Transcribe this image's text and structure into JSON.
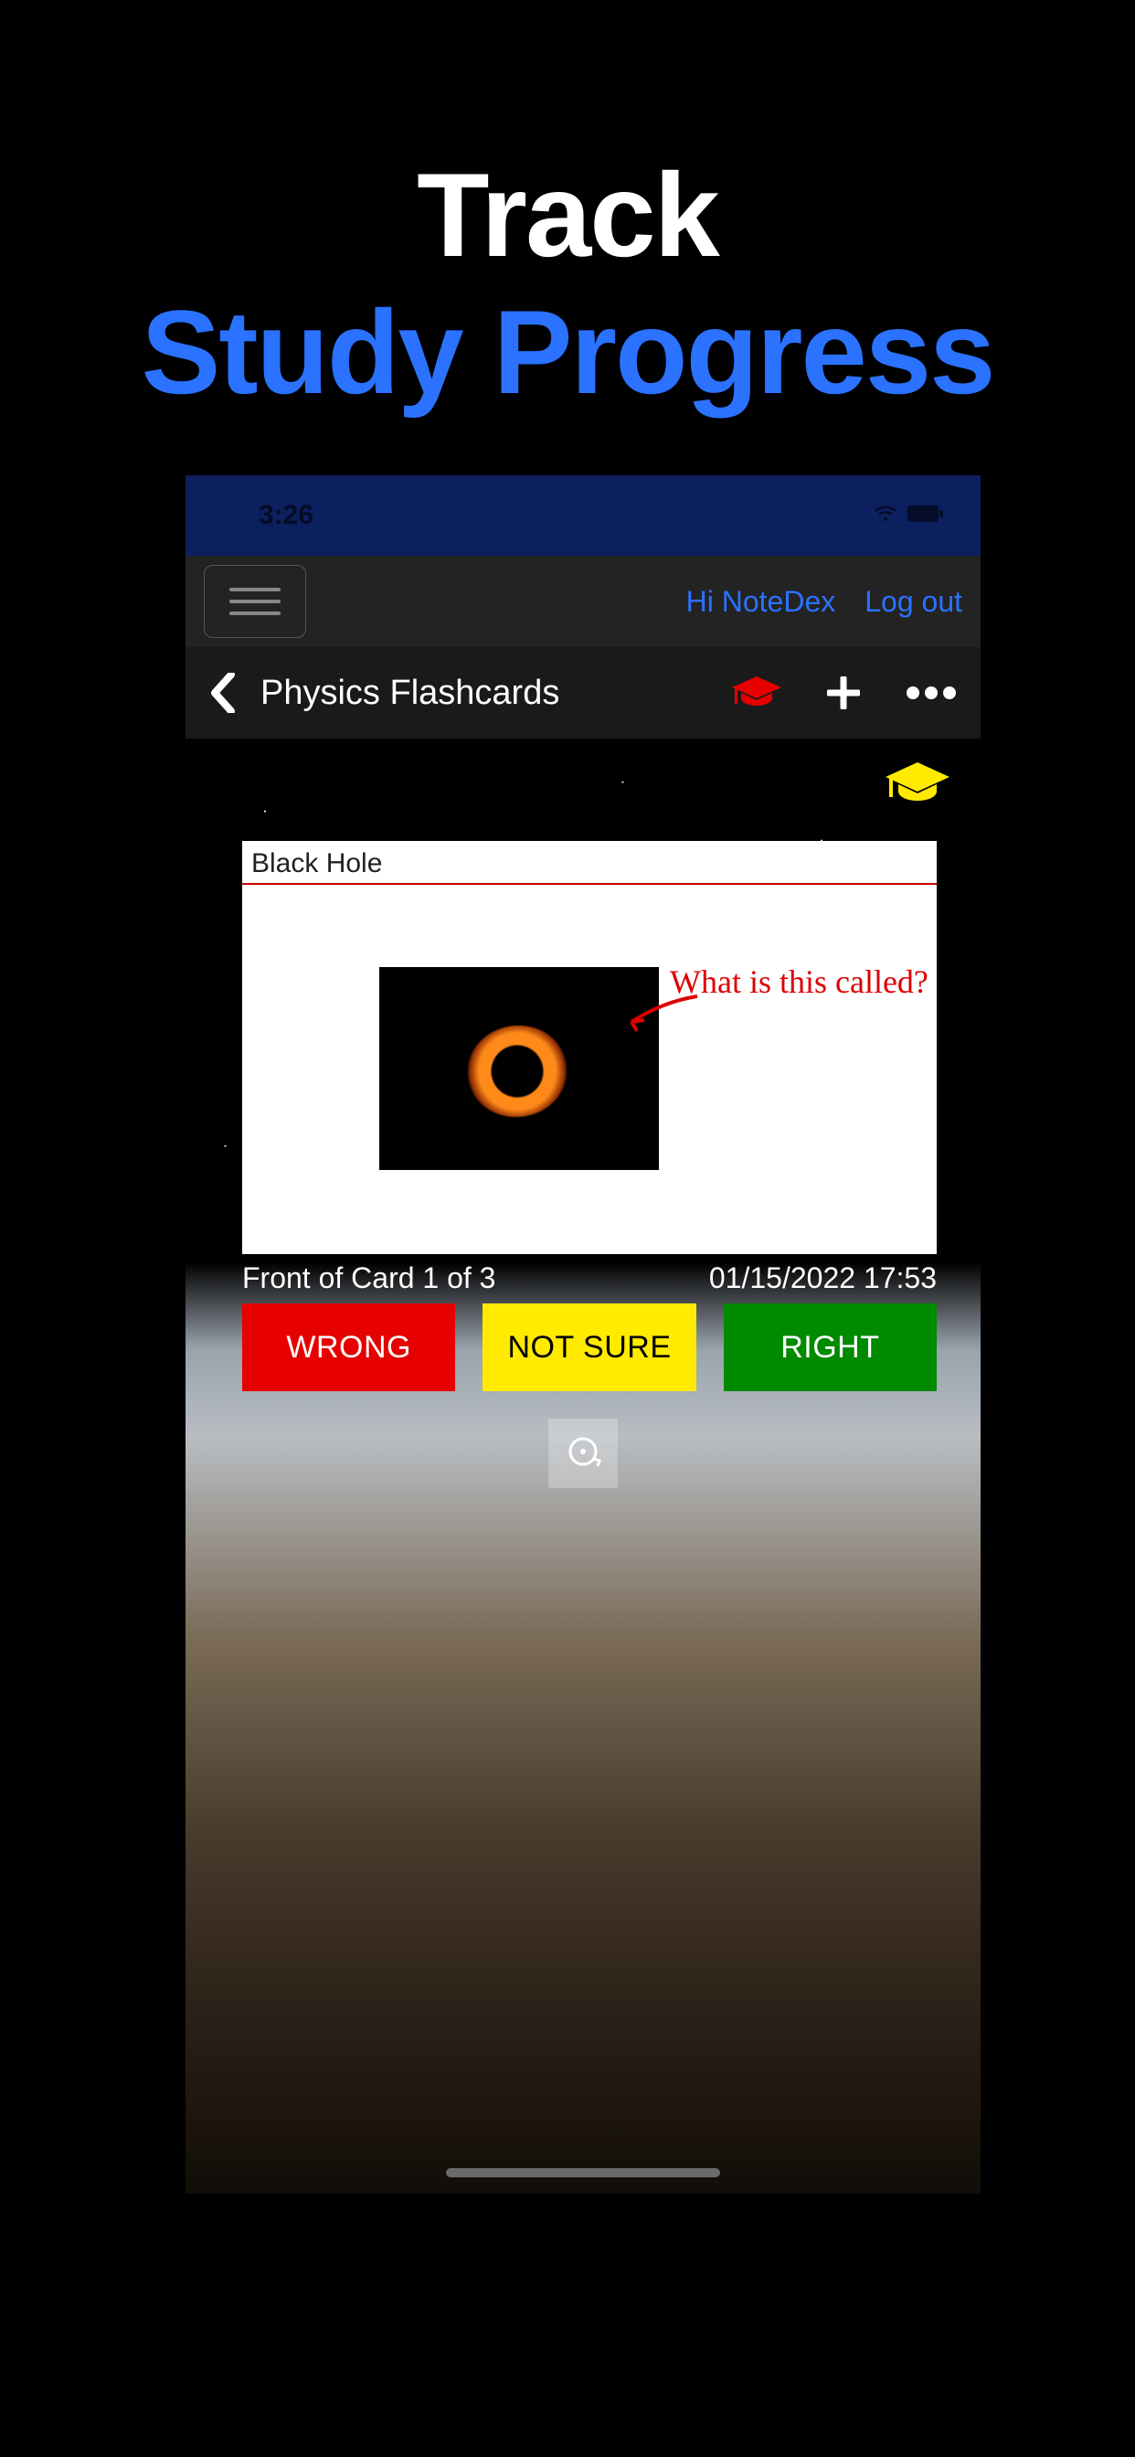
{
  "promo": {
    "line1": "Track",
    "line2": "Study Progress"
  },
  "status": {
    "time": "3:26"
  },
  "topnav": {
    "greeting": "Hi NoteDex",
    "logout": "Log out"
  },
  "titlebar": {
    "deck_title": "Physics Flashcards"
  },
  "card": {
    "title": "Black Hole",
    "annotation": "What is this called?",
    "position_label": "Front of Card 1 of 3",
    "timestamp": "01/15/2022 17:53"
  },
  "buttons": {
    "wrong": "WRONG",
    "notsure": "NOT SURE",
    "right": "RIGHT"
  },
  "colors": {
    "accent_blue": "#2a72ff",
    "cap_red": "#e60000",
    "cap_yellow": "#ffea00",
    "btn_green": "#008a00"
  }
}
